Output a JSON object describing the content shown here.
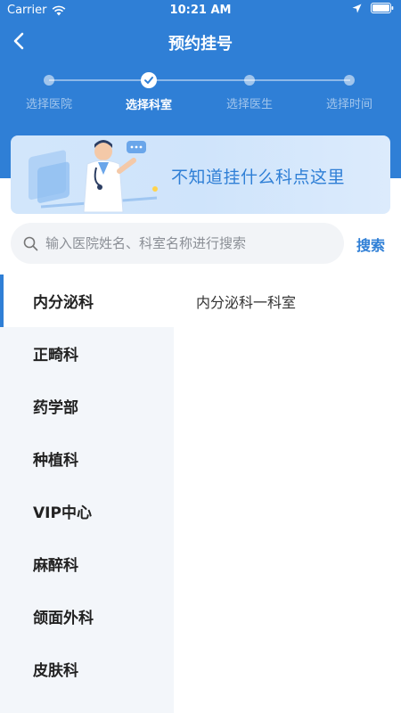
{
  "status_bar": {
    "carrier": "Carrier",
    "time": "10:21 AM",
    "icons": [
      "wifi-icon",
      "location-arrow-icon",
      "battery-icon"
    ]
  },
  "nav": {
    "title": "预约挂号",
    "back_icon": "chevron-left-icon"
  },
  "stepper": {
    "steps": [
      {
        "label": "选择医院",
        "state": "done"
      },
      {
        "label": "选择科室",
        "state": "current"
      },
      {
        "label": "选择医生",
        "state": "pending"
      },
      {
        "label": "选择时间",
        "state": "pending"
      }
    ]
  },
  "banner": {
    "text_before": "不知道挂什么科",
    "text_highlight": "点",
    "text_after": "这里",
    "illustration": "doctor-illustration"
  },
  "search": {
    "placeholder": "输入医院姓名、科室名称进行搜索",
    "value": "",
    "button_label": "搜索",
    "icon": "search-icon"
  },
  "departments": [
    {
      "label": "内分泌科",
      "selected": true
    },
    {
      "label": "正畸科",
      "selected": false
    },
    {
      "label": "药学部",
      "selected": false
    },
    {
      "label": "种植科",
      "selected": false
    },
    {
      "label": "VIP中心",
      "selected": false
    },
    {
      "label": "麻醉科",
      "selected": false
    },
    {
      "label": "颌面外科",
      "selected": false
    },
    {
      "label": "皮肤科",
      "selected": false
    }
  ],
  "sub_departments": [
    {
      "label": "内分泌科一科室"
    }
  ],
  "colors": {
    "primary": "#2f7fd6",
    "sidebar_bg": "#f3f6fa",
    "search_bg": "#f2f4f7",
    "highlight": "#ffe27a"
  }
}
